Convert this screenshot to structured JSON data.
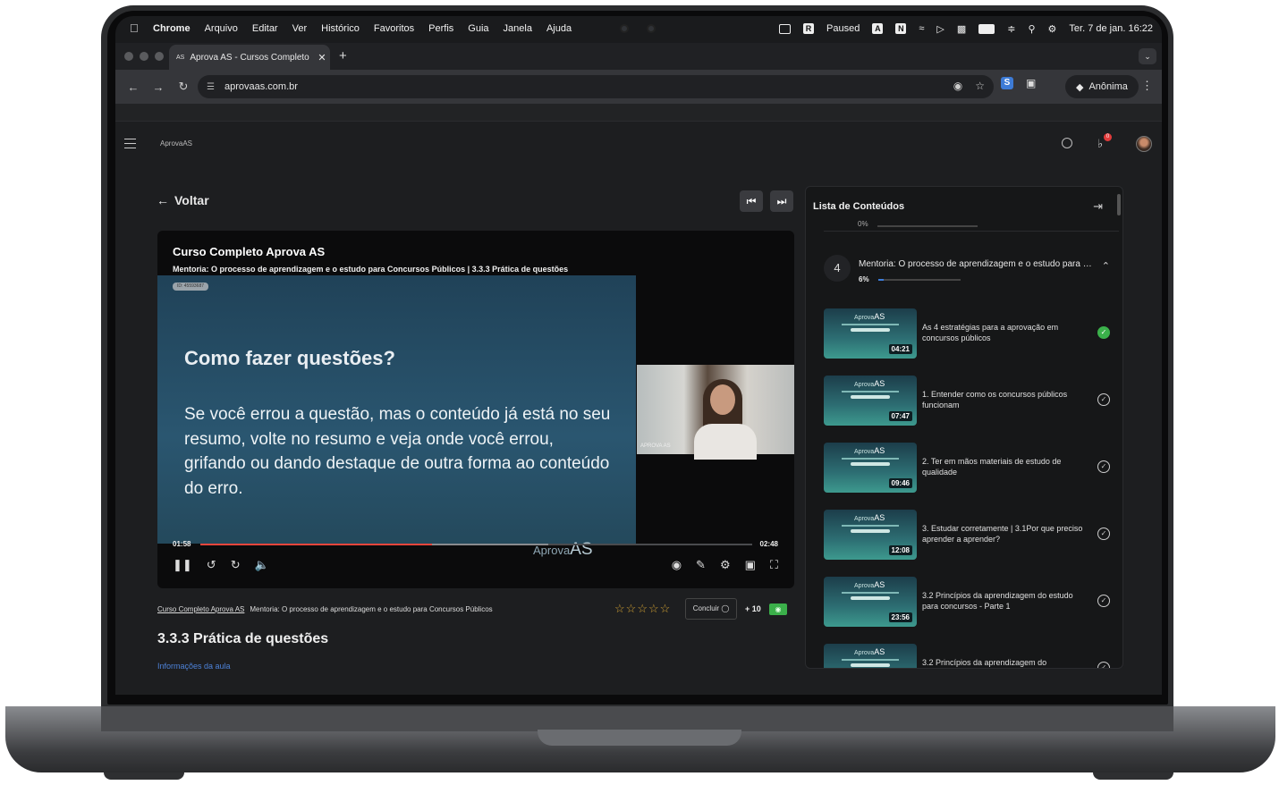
{
  "menubar": {
    "app": "Chrome",
    "items": [
      "Arquivo",
      "Editar",
      "Ver",
      "Histórico",
      "Favoritos",
      "Perfis",
      "Guia",
      "Janela",
      "Ajuda"
    ],
    "paused": "Paused",
    "clock": "Ter. 7 de jan.  16:22"
  },
  "browser": {
    "tab_title": "Aprova AS - Cursos Completo",
    "tab_favicon": "AS",
    "url": "aprovaas.com.br",
    "profile": "Anônima"
  },
  "site": {
    "logo": "AprovaAS",
    "notifications": "0",
    "back": "Voltar"
  },
  "player": {
    "course_title": "Curso Completo Aprova AS",
    "subtitle": "Mentoria: O processo de aprendizagem e o estudo para Concursos Públicos | 3.3.3 Prática de questões",
    "id_tag": "ID: 45593687",
    "slide_heading": "Como fazer questões?",
    "slide_text": "Se você errou a questão, mas o conteúdo já está no seu resumo, volte no resumo e veja onde você errou, grifando ou dando destaque de outra forma ao conteúdo do erro.",
    "watermark_a": "Aprova",
    "watermark_b": "AS",
    "webcam_label": "APROVA AS",
    "time_current": "01:58",
    "time_total": "02:48",
    "progress": 0.42,
    "buffered": 0.63
  },
  "lesson": {
    "crumb_course": "Curso Completo Aprova AS",
    "crumb_module": "Mentoria: O processo de aprendizagem e o estudo para Concursos Públicos",
    "rating_stars": 0,
    "conclude": "Concluir",
    "points": "+ 10",
    "title": "3.3.3 Prática de questões",
    "info_link": "Informações da aula"
  },
  "sidebar": {
    "title": "Lista de Conteúdos",
    "prev_module_pct": "0%",
    "module": {
      "number": "4",
      "title": "Mentoria: O processo de aprendizagem e o estudo para Concursos Públicos",
      "pct": "6%",
      "progress": 0.06
    },
    "thumb_text_a": "Aprova",
    "thumb_text_b": "AS",
    "items": [
      {
        "name": "As 4 estratégias para a aprovação em concursos públicos",
        "duration": "04:21",
        "done": true
      },
      {
        "name": "1. Entender como os concursos públicos funcionam",
        "duration": "07:47",
        "done": false
      },
      {
        "name": "2. Ter em mãos materiais de estudo de qualidade",
        "duration": "09:46",
        "done": false
      },
      {
        "name": "3. Estudar corretamente | 3.1Por que preciso aprender a aprender?",
        "duration": "12:08",
        "done": false
      },
      {
        "name": "3.2 Princípios da aprendizagem do estudo para concursos - Parte 1",
        "duration": "23:56",
        "done": false
      },
      {
        "name": "3.2 Princípios da aprendizagem do",
        "duration": "",
        "done": false
      }
    ]
  }
}
